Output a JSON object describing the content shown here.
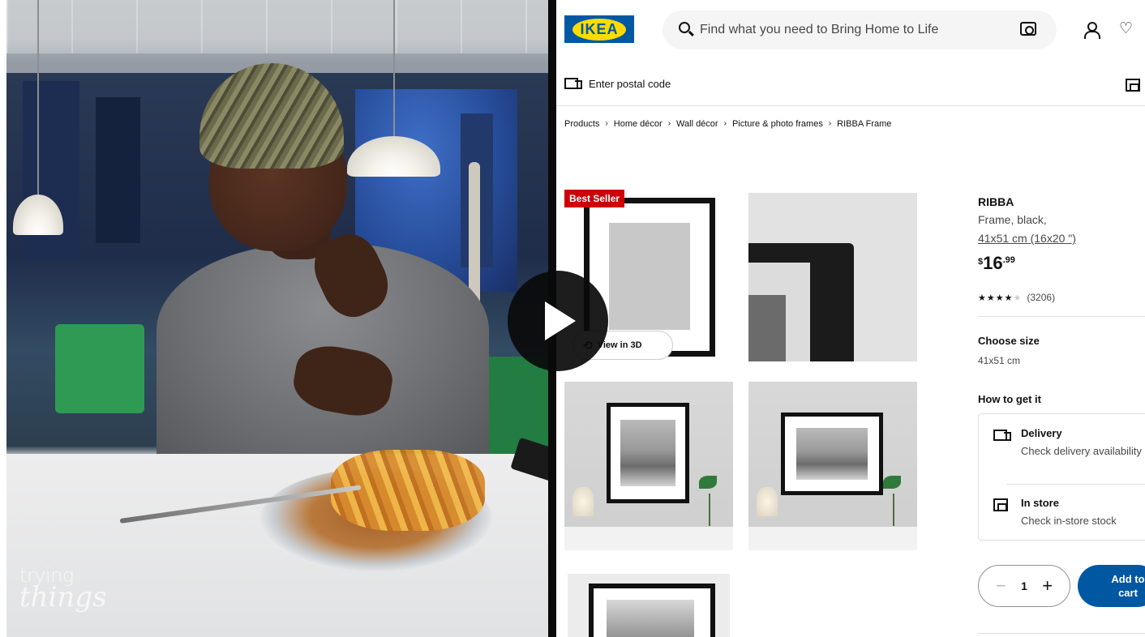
{
  "video": {
    "watermark_line1": "trying",
    "watermark_line2": "things"
  },
  "ikea": {
    "logo_text": "IKEA",
    "brand_color": "#0058a3",
    "logo_yellow": "#ffdb00",
    "search": {
      "placeholder": "Find what you need to Bring Home to Life",
      "icon": "search-icon",
      "camera_icon": "camera-icon"
    },
    "header_icons": [
      "user-icon",
      "heart-icon"
    ],
    "postal": {
      "label": "Enter postal code",
      "icon": "truck-icon"
    },
    "breadcrumb": [
      "Products",
      "Home décor",
      "Wall décor",
      "Picture & photo frames",
      "RIBBA Frame"
    ],
    "gallery": {
      "badge": "Best Seller",
      "badge_color": "#cc0008",
      "view_3d_label": "View in 3D"
    },
    "product": {
      "name": "RIBBA",
      "description": "Frame, black,",
      "size": "41x51 cm (16x20 \")",
      "price_currency": "$",
      "price_integer": "16",
      "price_decimal": ".99",
      "rating_stars": 4,
      "rating_max": 5,
      "rating_count": "(3206)",
      "choose_size_label": "Choose size",
      "size_value": "41x51 cm",
      "how_to_get_label": "How to get it",
      "delivery_title": "Delivery",
      "delivery_sub": "Check delivery availability",
      "store_title": "In store",
      "store_sub": "Check in-store stock",
      "quantity": "1",
      "qty_minus": "−",
      "qty_plus": "+",
      "add_to_cart_line1": "Add to",
      "add_to_cart_line2": "cart"
    }
  }
}
